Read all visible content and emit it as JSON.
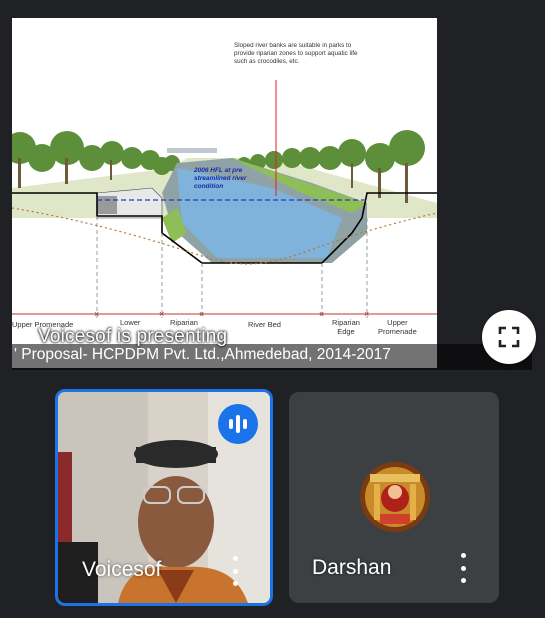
{
  "presentation": {
    "presenting_label": "Voicesof is presenting",
    "caption": "' Proposal- HCPDPM Pvt. Ltd.,Ahmedebad, 2014-2017",
    "slide": {
      "annotation": "Sloped river banks are suitable in parks to provide riparian zones to support aquatic life such as crocodiles, etc.",
      "hfl_label_1": "2006 HFL at pre",
      "hfl_label_2": "streamlined river",
      "hfl_label_3": "condition",
      "zones": [
        "Upper Promenade",
        "Lower",
        "Riparian",
        "River Bed",
        "Riparian",
        "Upper"
      ],
      "zones_sub": [
        "",
        "",
        "",
        "",
        "Edge",
        "Promenade"
      ]
    }
  },
  "controls": {
    "fullscreen_icon": "fullscreen-icon"
  },
  "participants": [
    {
      "name": "Voicesof",
      "speaking": true,
      "icon": "audio-level-icon"
    },
    {
      "name": "Darshan",
      "speaking": false,
      "icon": "more-options-icon"
    }
  ],
  "colors": {
    "background": "#202124",
    "active_speaker": "#1a73e8",
    "tile": "#3c4043",
    "water": "#7fb3dc"
  }
}
